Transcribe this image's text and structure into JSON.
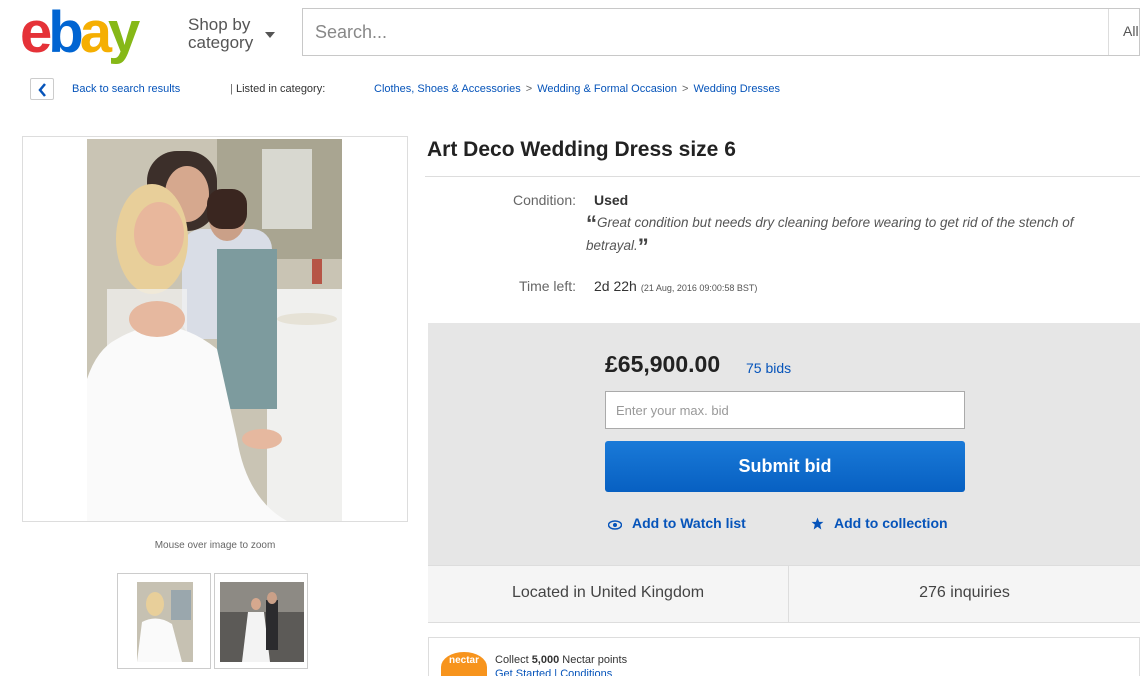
{
  "header": {
    "logo_letters": [
      "e",
      "b",
      "a",
      "y"
    ],
    "logo_colors": [
      "#e53238",
      "#0064d2",
      "#f5af02",
      "#86b817"
    ],
    "shop_by_category": "Shop by category",
    "search_placeholder": "Search...",
    "search_category": "All"
  },
  "breadcrumb": {
    "back_label": "Back to search results",
    "separator": "|",
    "listed_in": "Listed in category:",
    "categories": [
      "Clothes, Shoes & Accessories",
      "Wedding & Formal Occasion",
      "Wedding Dresses"
    ],
    "arrow": ">"
  },
  "gallery": {
    "zoom_hint": "Mouse over image to zoom",
    "thumbnail_count": 2
  },
  "item": {
    "title": "Art Deco Wedding Dress size 6",
    "condition_label": "Condition:",
    "condition_value": "Used",
    "condition_note": "Great condition but needs dry cleaning before wearing to get rid of the stench of betrayal.",
    "time_left_label": "Time left:",
    "time_left_value": "2d 22h",
    "end_date": "(21 Aug, 2016   09:00:58 BST)"
  },
  "bid": {
    "price": "£65,900.00",
    "bid_count": "75 bids",
    "input_placeholder": "Enter your max. bid",
    "submit_label": "Submit bid",
    "watch_label": "Add to Watch list",
    "collection_label": "Add to collection",
    "accent": "#0654ba"
  },
  "info": {
    "location": "Located in United Kingdom",
    "inquiries": "276 inquiries"
  },
  "nectar": {
    "logo_text": "nectar",
    "collect_prefix": "Collect",
    "points": "5,000",
    "collect_suffix": "Nectar points",
    "links": "Get Started | Conditions"
  }
}
